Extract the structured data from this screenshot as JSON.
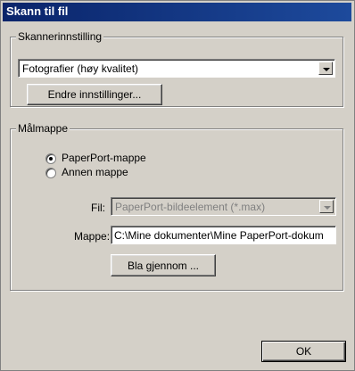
{
  "window": {
    "title": "Skann til fil"
  },
  "scanner_group": {
    "legend": "Skannerinnstilling",
    "preset_value": "Fotografier (høy kvalitet)",
    "change_button": "Endre innstillinger..."
  },
  "target_group": {
    "legend": "Målmappe",
    "radio_paperport": "PaperPort-mappe",
    "radio_other": "Annen mappe",
    "selected_radio": "PaperPort-mappe",
    "file_label": "Fil:",
    "file_value": "PaperPort-bildeelement (*.max)",
    "folder_label": "Mappe:",
    "folder_value": "C:\\Mine dokumenter\\Mine PaperPort-dokum",
    "browse_button": "Bla gjennom ..."
  },
  "footer": {
    "ok_button": "OK"
  },
  "colors": {
    "title_bar": "#0a246a",
    "dialog_bg": "#d4d0c8",
    "disabled_text": "#808080"
  }
}
